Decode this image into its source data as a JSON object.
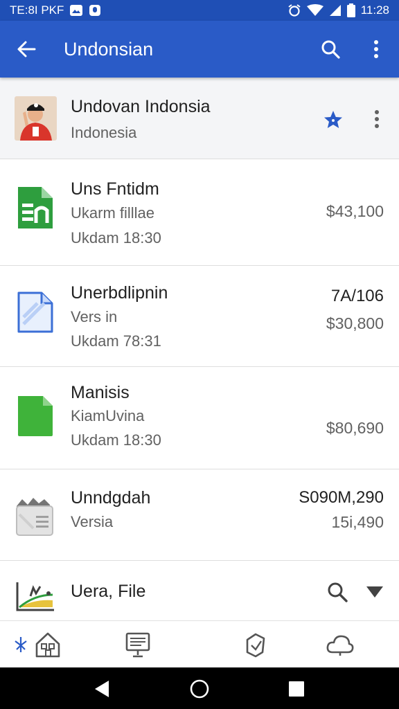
{
  "status_bar": {
    "left_text": "TE:8I PKF",
    "time": "11:28",
    "icons": [
      "image-icon",
      "notification-icon",
      "alarm-icon",
      "wifi-icon",
      "signal-icon",
      "battery-icon"
    ]
  },
  "app_bar": {
    "title": "Undonsian",
    "back_icon": "arrow-back-icon",
    "search_icon": "search-icon",
    "more_icon": "more-vert-icon"
  },
  "header": {
    "title": "Undovan Indonsia",
    "subtitle": "Indonesia",
    "star_color": "#2a5bc7"
  },
  "files": [
    {
      "name": "Uns Fntidm",
      "line2": "Ukarm filllae",
      "line3": "Ukdam 18:30",
      "right1": "",
      "right2": "$43,100",
      "icon": "spreadsheet-icon",
      "color": "#2e9e3e"
    },
    {
      "name": "Unerbdlipnin",
      "line2": "Vers in",
      "line3": "Ukdam 78:31",
      "right1": "7A/106",
      "right2": "$30,800",
      "icon": "document-icon",
      "color": "#3b6fd6"
    },
    {
      "name": "Manisis",
      "line2": "KiamUvina",
      "line3": "Ukdam 18:30",
      "right1": "",
      "right2": "$80,690",
      "icon": "green-file-icon",
      "color": "#3fb33a"
    },
    {
      "name": "Unndgdah",
      "line2": "Versia",
      "line3": "",
      "right1": "S090M,290",
      "right2": "15i,490",
      "icon": "folder-stack-icon",
      "color": "#bdbdbd"
    }
  ],
  "partial_row": {
    "name": "Uera, File",
    "icon": "chart-file-icon",
    "search_icon": "search-icon",
    "dropdown_icon": "dropdown-arrow-icon"
  },
  "bottom_nav": {
    "items": [
      "pin-icon",
      "home-icon",
      "presentation-icon",
      "bookmark-icon",
      "cloud-icon"
    ]
  },
  "system_nav": {
    "items": [
      "back-triangle-icon",
      "home-circle-icon",
      "recents-square-icon"
    ]
  }
}
